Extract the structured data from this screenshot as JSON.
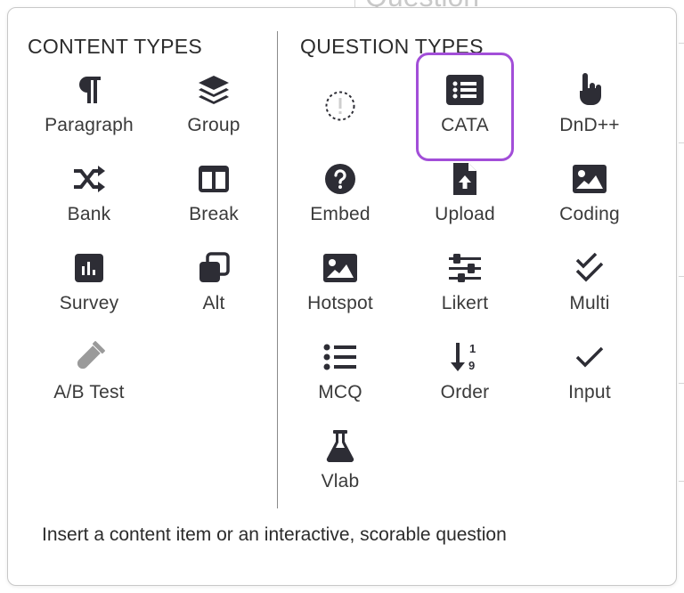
{
  "background": {
    "heading": "Question"
  },
  "content_types": {
    "title": "CONTENT TYPES",
    "items": [
      {
        "label": "Paragraph",
        "icon": "paragraph-icon"
      },
      {
        "label": "Group",
        "icon": "layers-icon"
      },
      {
        "label": "Bank",
        "icon": "shuffle-icon"
      },
      {
        "label": "Break",
        "icon": "columns-icon"
      },
      {
        "label": "Survey",
        "icon": "poll-icon"
      },
      {
        "label": "Alt",
        "icon": "clone-icon"
      },
      {
        "label": "A/B Test",
        "icon": "vial-icon"
      }
    ]
  },
  "question_types": {
    "title": "QUESTION TYPES",
    "items": [
      {
        "label": "",
        "icon": "dashed-exclamation-icon"
      },
      {
        "label": "CATA",
        "icon": "checklist-icon",
        "highlighted": true
      },
      {
        "label": "DnD++",
        "icon": "hand-pointer-icon"
      },
      {
        "label": "Embed",
        "icon": "question-circle-icon"
      },
      {
        "label": "Upload",
        "icon": "file-upload-icon"
      },
      {
        "label": "Coding",
        "icon": "image-icon"
      },
      {
        "label": "Hotspot",
        "icon": "image-icon"
      },
      {
        "label": "Likert",
        "icon": "sliders-icon"
      },
      {
        "label": "Multi",
        "icon": "double-check-icon"
      },
      {
        "label": "MCQ",
        "icon": "list-icon"
      },
      {
        "label": "Order",
        "icon": "sort-numeric-icon"
      },
      {
        "label": "Input",
        "icon": "check-icon"
      },
      {
        "label": "Vlab",
        "icon": "flask-icon"
      }
    ]
  },
  "footer": {
    "text": "Insert a content item or an interactive, scorable question"
  },
  "colors": {
    "highlight": "#a24ed8",
    "icon": "#2d2d35",
    "icon_disabled": "#9a9a9a"
  }
}
